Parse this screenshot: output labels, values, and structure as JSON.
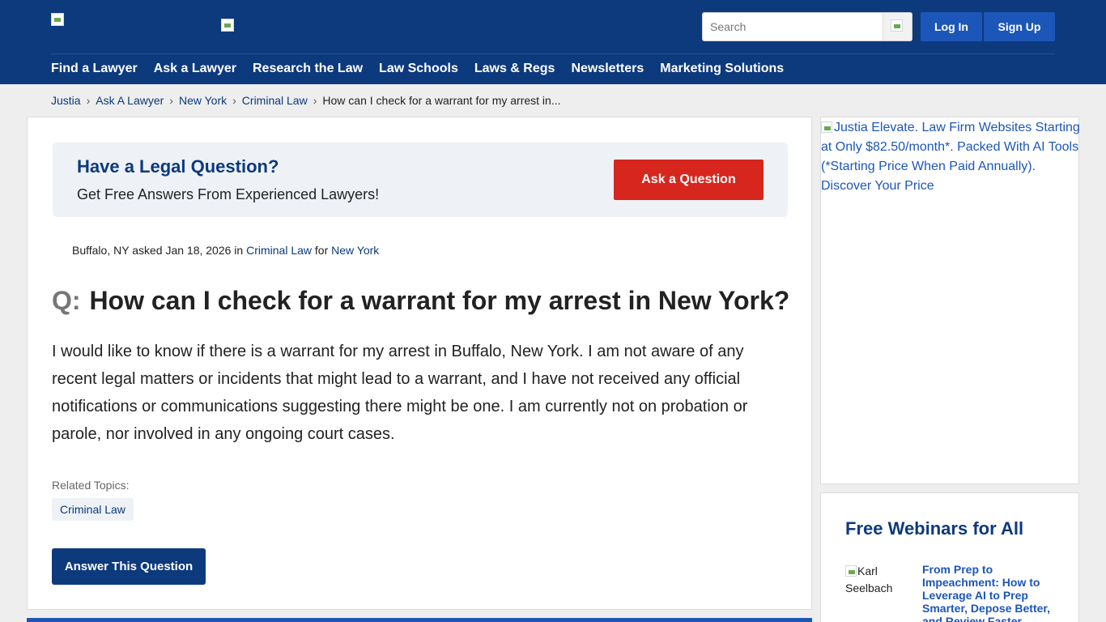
{
  "header": {
    "search_placeholder": "Search",
    "login_label": "Log In",
    "signup_label": "Sign Up",
    "nav": [
      "Find a Lawyer",
      "Ask a Lawyer",
      "Research the Law",
      "Law Schools",
      "Laws & Regs",
      "Newsletters",
      "Marketing Solutions"
    ]
  },
  "breadcrumb": {
    "items": [
      "Justia",
      "Ask A Lawyer",
      "New York",
      "Criminal Law"
    ],
    "current": "How can I check for a warrant for my arrest in...",
    "separator": "›"
  },
  "promo": {
    "title": "Have a Legal Question?",
    "subtitle": "Get Free Answers From Experienced Lawyers!",
    "button": "Ask a Question"
  },
  "question": {
    "location": "Buffalo, NY",
    "asked": "asked Jan 18, 2026 in",
    "category": "Criminal Law",
    "for": "for",
    "state": "New York",
    "prefix": "Q:",
    "title": "How can I check for a warrant for my arrest in New York?",
    "body": "I would like to know if there is a warrant for my arrest in Buffalo, New York. I am not aware of any recent legal matters or incidents that might lead to a warrant, and I have not received any official notifications or communications suggesting there might be one. I am currently not on probation or parole, nor involved in any ongoing court cases.",
    "related_label": "Related Topics:",
    "related_tags": [
      "Criminal Law"
    ],
    "answer_button": "Answer This Question"
  },
  "sidebar": {
    "ad_alt": "Justia Elevate. Law Firm Websites Starting at Only $82.50/month*. Packed With AI Tools (*Starting Price When Paid Annually). Discover Your Price",
    "webinars_title": "Free Webinars for All",
    "speaker_alt": "Karl Seelbach",
    "webinar_title": "From Prep to Impeachment: How to Leverage AI to Prep Smarter, Depose Better, and Review Faster"
  },
  "colors": {
    "header_bg": "#0d3a7d",
    "button_blue": "#1c56b8",
    "ask_red": "#d7261e",
    "link": "#0a3a7a"
  }
}
